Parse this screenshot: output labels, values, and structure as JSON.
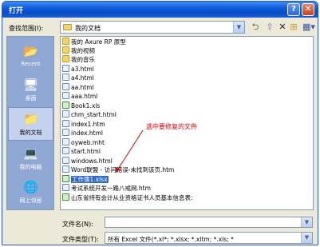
{
  "dialog": {
    "title": "打开"
  },
  "titlebar": {
    "help": "?",
    "close": "✕"
  },
  "lookin": {
    "label": "查找范围(I):",
    "value": "我的文档"
  },
  "toolbar": {
    "back": "⮌",
    "up": "⇧",
    "delete": "✕",
    "newfolder": "⊞",
    "views": "▦▾"
  },
  "places": [
    {
      "label": "Recent",
      "icon": "recent-folder-icon"
    },
    {
      "label": "桌面",
      "icon": "desktop-icon"
    },
    {
      "label": "我的文档",
      "icon": "my-documents-icon"
    },
    {
      "label": "我的电脑",
      "icon": "my-computer-icon"
    },
    {
      "label": "网上邻居",
      "icon": "network-places-icon"
    }
  ],
  "files": [
    {
      "name": "我的 Axure RP 原型",
      "type": "folder"
    },
    {
      "name": "我的视频",
      "type": "folder"
    },
    {
      "name": "我的音乐",
      "type": "folder"
    },
    {
      "name": "a3.html",
      "type": "html"
    },
    {
      "name": "a4.html",
      "type": "html"
    },
    {
      "name": "aa.html",
      "type": "html"
    },
    {
      "name": "aaa.html",
      "type": "html"
    },
    {
      "name": "Book1.xls",
      "type": "xls"
    },
    {
      "name": "chm_start.html",
      "type": "html"
    },
    {
      "name": "index1.htm",
      "type": "html"
    },
    {
      "name": "index.html",
      "type": "html"
    },
    {
      "name": "oyweb.mht",
      "type": "html"
    },
    {
      "name": "start.html",
      "type": "html"
    },
    {
      "name": "windows.html",
      "type": "html"
    },
    {
      "name": "Word联盟 - 访问错误-未找到该页.htm",
      "type": "html"
    },
    {
      "name": "工作簿1.xlsx",
      "type": "xls",
      "selected": true
    },
    {
      "name": "考试系统开发一路八戒网.htm",
      "type": "html"
    },
    {
      "name": "山东省持有会计从业资格证书人员基本信息表:",
      "type": "xls"
    }
  ],
  "annotation": {
    "text": "选中要修复的文件",
    "color": "#e00000"
  },
  "filename": {
    "label": "文件名(N):",
    "value": ""
  },
  "filetype": {
    "label": "文件类型(T):",
    "value": "所有 Excel 文件(*.xl*; *.xlsx; *.xltm; *.xls; *"
  }
}
